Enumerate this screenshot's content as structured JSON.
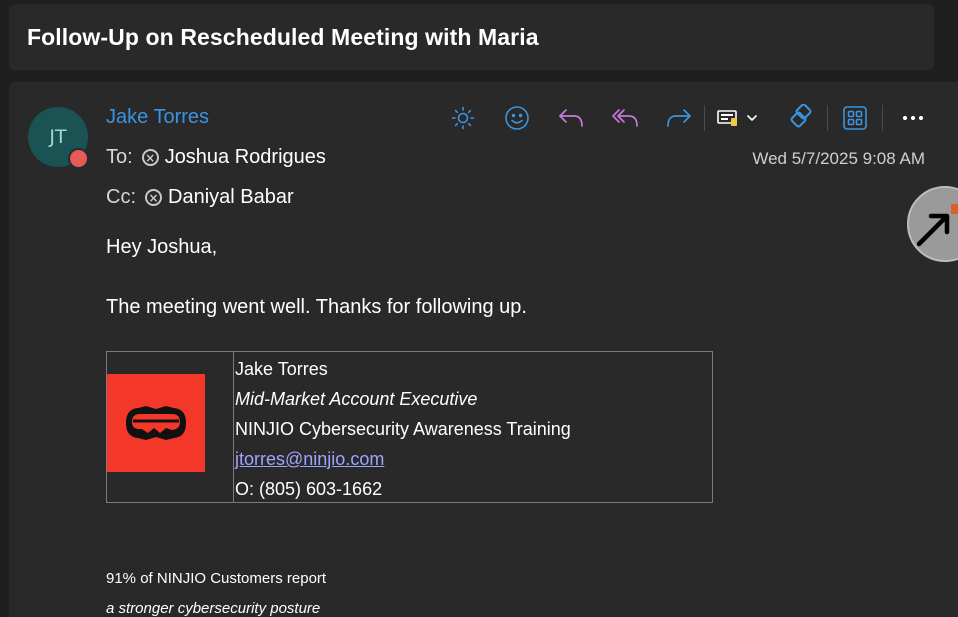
{
  "subject": "Follow-Up on Rescheduled Meeting with Maria",
  "sender": {
    "initials": "JT",
    "name": "Jake Torres",
    "avatar_color": "#1b5253",
    "presence_color": "#e85a5a"
  },
  "to": {
    "label": "To:",
    "name": "Joshua Rodrigues"
  },
  "cc": {
    "label": "Cc:",
    "name": "Daniyal Babar"
  },
  "date": "Wed 5/7/2025 9:08 AM",
  "toolbar": {
    "icons": [
      "sun-icon",
      "emoji-icon",
      "reply-icon",
      "reply-all-icon",
      "forward-icon",
      "immersive-reader-icon",
      "chevron-down-icon",
      "loop-icon",
      "apps-icon",
      "more-icon"
    ],
    "accent_blue": "#3b94e0",
    "accent_purple": "#c779d6"
  },
  "body": {
    "greeting": "Hey Joshua,",
    "line1": "The meeting went well. Thanks for following up."
  },
  "signature": {
    "name": "Jake Torres",
    "title": "Mid-Market Account Executive",
    "company": "NINJIO Cybersecurity Awareness Training",
    "email": "jtorres@ninjio.com",
    "phone": "O: (805) 603-1662",
    "logo_color": "#f3382a"
  },
  "footer": {
    "line1": "91% of NINJIO Customers report",
    "line2": "a stronger cybersecurity posture"
  }
}
